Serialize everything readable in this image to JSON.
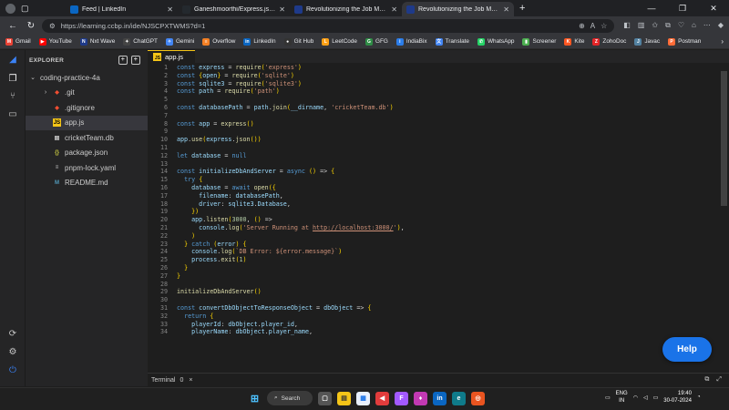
{
  "browser": {
    "tabs": [
      {
        "title": "Feed | LinkedIn",
        "favicon": "linkedin-icon",
        "color": "#0a66c2",
        "active": false
      },
      {
        "title": "Ganeshmoorthi/Express.js-Crick",
        "favicon": "github-icon",
        "color": "#24292e",
        "active": false
      },
      {
        "title": "Revolutionizing the Job Market |",
        "favicon": "nxtwave-icon",
        "color": "#1e3a8a",
        "active": false
      },
      {
        "title": "Revolutionizing the Job Market |",
        "favicon": "nxtwave-icon",
        "color": "#1e3a8a",
        "active": true
      }
    ],
    "new_tab": "+",
    "address": "https://learning.ccbp.in/ide/NJSCPXTWMS?d=1",
    "window_controls": [
      "—",
      "❐",
      "✕"
    ]
  },
  "bookmarks": [
    {
      "label": "Gmail",
      "icon": "gmail-icon",
      "color": "#ea4335",
      "glyph": "M"
    },
    {
      "label": "YouTube",
      "icon": "youtube-icon",
      "color": "#ff0000",
      "glyph": "▶"
    },
    {
      "label": "Nxt Wave",
      "icon": "nxtwave-icon",
      "color": "#1e3a8a",
      "glyph": "N"
    },
    {
      "label": "ChatGPT",
      "icon": "chatgpt-icon",
      "color": "#444",
      "glyph": "✦"
    },
    {
      "label": "Gemini",
      "icon": "gemini-icon",
      "color": "#4285f4",
      "glyph": "✧"
    },
    {
      "label": "Overflow",
      "icon": "stackoverflow-icon",
      "color": "#f48024",
      "glyph": "≡"
    },
    {
      "label": "LinkedIn",
      "icon": "linkedin-icon",
      "color": "#0a66c2",
      "glyph": "in"
    },
    {
      "label": "Git Hub",
      "icon": "github-icon",
      "color": "#333",
      "glyph": "●"
    },
    {
      "label": "LeetCode",
      "icon": "leetcode-icon",
      "color": "#ffa116",
      "glyph": "L"
    },
    {
      "label": "GFG",
      "icon": "gfg-icon",
      "color": "#2f8d46",
      "glyph": "G"
    },
    {
      "label": "IndiaBix",
      "icon": "indiabix-icon",
      "color": "#2b7de9",
      "glyph": "i"
    },
    {
      "label": "Translate",
      "icon": "translate-icon",
      "color": "#4285f4",
      "glyph": "文"
    },
    {
      "label": "WhatsApp",
      "icon": "whatsapp-icon",
      "color": "#25d366",
      "glyph": "✆"
    },
    {
      "label": "Screener",
      "icon": "screener-icon",
      "color": "#4caf50",
      "glyph": "▮"
    },
    {
      "label": "Kite",
      "icon": "kite-icon",
      "color": "#ff5722",
      "glyph": "K"
    },
    {
      "label": "ZohoDoc",
      "icon": "zoho-icon",
      "color": "#e42527",
      "glyph": "Z"
    },
    {
      "label": "Javac",
      "icon": "java-icon",
      "color": "#5382a1",
      "glyph": "J"
    },
    {
      "label": "Postman",
      "icon": "postman-icon",
      "color": "#ff6c37",
      "glyph": "P"
    }
  ],
  "explorer": {
    "title": "EXPLORER",
    "tree": [
      {
        "label": "coding-practice-4a",
        "type": "folder-open",
        "depth": 0
      },
      {
        "label": ".git",
        "type": "git-folder",
        "depth": 1
      },
      {
        "label": ".gitignore",
        "type": "git",
        "depth": 1
      },
      {
        "label": "app.js",
        "type": "js",
        "depth": 1,
        "selected": true
      },
      {
        "label": "cricketTeam.db",
        "type": "db",
        "depth": 1
      },
      {
        "label": "package.json",
        "type": "json",
        "depth": 1
      },
      {
        "label": "pnpm-lock.yaml",
        "type": "yaml",
        "depth": 1
      },
      {
        "label": "README.md",
        "type": "md",
        "depth": 1
      }
    ]
  },
  "editor": {
    "tab": "app.js",
    "lines": [
      {
        "n": 1,
        "code": "const express = require('express')"
      },
      {
        "n": 2,
        "code": "const {open} = require('sqlite')"
      },
      {
        "n": 3,
        "code": "const sqlite3 = require('sqlite3')"
      },
      {
        "n": 4,
        "code": "const path = require('path')"
      },
      {
        "n": 5,
        "code": ""
      },
      {
        "n": 6,
        "code": "const databasePath = path.join(__dirname, 'cricketTeam.db')"
      },
      {
        "n": 7,
        "code": ""
      },
      {
        "n": 8,
        "code": "const app = express()"
      },
      {
        "n": 9,
        "code": ""
      },
      {
        "n": 10,
        "code": "app.use(express.json())"
      },
      {
        "n": 11,
        "code": ""
      },
      {
        "n": 12,
        "code": "let database = null"
      },
      {
        "n": 13,
        "code": ""
      },
      {
        "n": 14,
        "code": "const initializeDbAndServer = async () => {"
      },
      {
        "n": 15,
        "code": "  try {"
      },
      {
        "n": 16,
        "code": "    database = await open({"
      },
      {
        "n": 17,
        "code": "      filename: databasePath,"
      },
      {
        "n": 18,
        "code": "      driver: sqlite3.Database,"
      },
      {
        "n": 19,
        "code": "    })"
      },
      {
        "n": 20,
        "code": "    app.listen(3000, () =>"
      },
      {
        "n": 21,
        "code": "      console.log('Server Running at http://localhost:3000/'),"
      },
      {
        "n": 22,
        "code": "    )"
      },
      {
        "n": 23,
        "code": "  } catch (error) {"
      },
      {
        "n": 24,
        "code": "    console.log(`DB Error: ${error.message}`)"
      },
      {
        "n": 25,
        "code": "    process.exit(1)"
      },
      {
        "n": 26,
        "code": "  }"
      },
      {
        "n": 27,
        "code": "}"
      },
      {
        "n": 28,
        "code": ""
      },
      {
        "n": 29,
        "code": "initializeDbAndServer()"
      },
      {
        "n": 30,
        "code": ""
      },
      {
        "n": 31,
        "code": "const convertDbObjectToResponseObject = dbObject => {"
      },
      {
        "n": 32,
        "code": "  return {"
      },
      {
        "n": 33,
        "code": "    playerId: dbObject.player_id,"
      },
      {
        "n": 34,
        "code": "    playerName: dbObject.player_name,"
      }
    ]
  },
  "terminal": {
    "label": "Terminal",
    "count": "0",
    "close": "×"
  },
  "help_button": "Help",
  "taskbar": {
    "search": "Search",
    "lang_top": "ENG",
    "lang_bottom": "IN",
    "time": "19:40",
    "date": "30-07-2024"
  }
}
